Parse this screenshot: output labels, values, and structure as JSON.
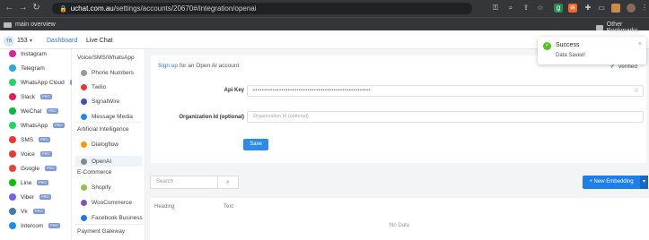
{
  "browser": {
    "url_prefix": "uchat.com.au",
    "url_path": "/settings/accounts/20670#/integration/openai",
    "bookmark_folder": "main overview",
    "other_bookmarks": "Other Bookmarks"
  },
  "header": {
    "bot_avatar": "TB",
    "bot_count": "153",
    "tabs": [
      "Dashboard",
      "Live Chat"
    ],
    "active_tab_color": "#2b7bd6"
  },
  "channels": [
    {
      "label": "Instagram",
      "icon": "instagram-icon",
      "color": "#d6249f",
      "pro": false
    },
    {
      "label": "Telegram",
      "icon": "telegram-icon",
      "color": "#2ca5e0",
      "pro": false
    },
    {
      "label": "WhatsApp Cloud",
      "icon": "whatsapp-icon",
      "color": "#25d366",
      "pro": true
    },
    {
      "label": "Slack",
      "icon": "slack-icon",
      "color": "#e01e5a",
      "pro": true
    },
    {
      "label": "WeChat",
      "icon": "wechat-icon",
      "color": "#09b83e",
      "pro": true
    },
    {
      "label": "WhatsApp",
      "icon": "whatsapp-icon",
      "color": "#25d366",
      "pro": true
    },
    {
      "label": "SMS",
      "icon": "sms-icon",
      "color": "#e53935",
      "pro": true
    },
    {
      "label": "Voice",
      "icon": "voice-icon",
      "color": "#e53935",
      "pro": true
    },
    {
      "label": "Google",
      "icon": "google-icon",
      "color": "#ea4335",
      "pro": true
    },
    {
      "label": "Line",
      "icon": "line-icon",
      "color": "#00c300",
      "pro": true
    },
    {
      "label": "Viber",
      "icon": "viber-icon",
      "color": "#7360f2",
      "pro": true
    },
    {
      "label": "Vk",
      "icon": "vk-icon",
      "color": "#4a76a8",
      "pro": true
    },
    {
      "label": "Intercom",
      "icon": "intercom-icon",
      "color": "#1f8ded",
      "pro": true
    }
  ],
  "integrations": {
    "sections": [
      {
        "title": "Voice/SMS/WhatsApp",
        "items": [
          {
            "label": "Phone Numbers",
            "color": "#999"
          },
          {
            "label": "Twilio",
            "color": "#e53935"
          },
          {
            "label": "SignalWire",
            "color": "#3f51b5"
          },
          {
            "label": "Message Media",
            "color": "#1e88e5"
          }
        ]
      },
      {
        "title": "Artificial Intelligence",
        "items": [
          {
            "label": "Dialogflow",
            "color": "#ff9800"
          },
          {
            "label": "OpenAI",
            "color": "#888"
          }
        ]
      },
      {
        "title": "E-Commerce",
        "items": [
          {
            "label": "Shopify",
            "color": "#95bf47"
          },
          {
            "label": "WooCommerce",
            "color": "#7f54b3"
          },
          {
            "label": "Facebook Business",
            "color": "#1877f2"
          }
        ]
      },
      {
        "title": "Payment Gateway",
        "items": []
      }
    ]
  },
  "form": {
    "signup_link": "Sign up",
    "signup_text": "for an Open AI account",
    "verified": "Verified",
    "api_key_label": "Api Key",
    "api_key_value": "••••••••••••••••••••••••••••••••••••••••••••••••••••••",
    "org_label": "Organization Id (optional)",
    "org_placeholder": "Organization Id (optional)",
    "save_label": "Save"
  },
  "table": {
    "search_placeholder": "Search",
    "new_button": "+ New Embedding",
    "columns": [
      "Heading",
      "Text"
    ],
    "empty": "No Data"
  },
  "toast": {
    "title": "Success",
    "message": "Data Saved!"
  }
}
